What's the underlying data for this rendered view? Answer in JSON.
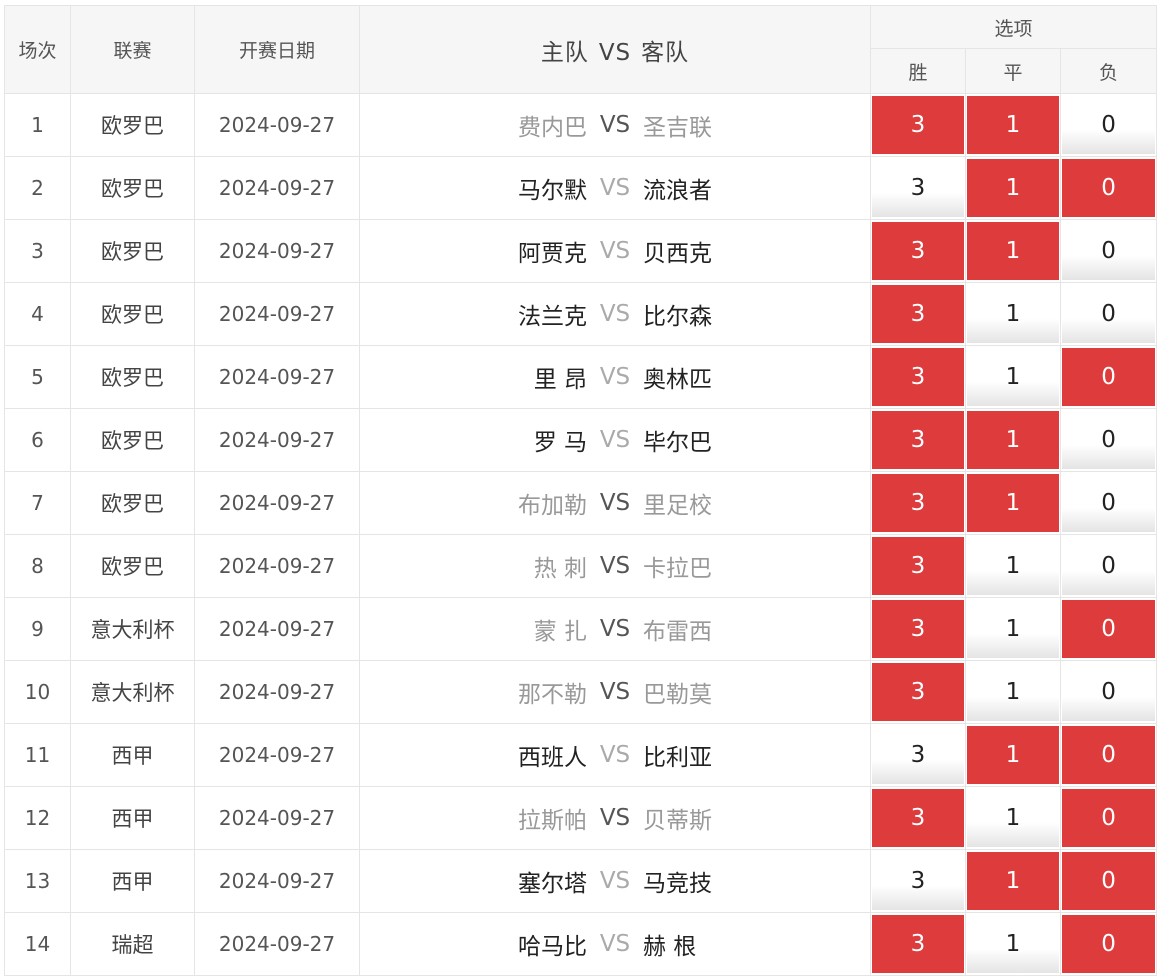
{
  "header": {
    "col_index": "场次",
    "col_league": "联赛",
    "col_date": "开赛日期",
    "col_home": "主队",
    "col_vs": "VS",
    "col_away": "客队",
    "col_options": "选项",
    "col_win": "胜",
    "col_draw": "平",
    "col_loss": "负"
  },
  "colors": {
    "selected": "#dd3b3c"
  },
  "rows": [
    {
      "idx": "1",
      "league": "欧罗巴",
      "date": "2024-09-27",
      "home": "费内巴",
      "vs": "VS",
      "away": "圣吉联",
      "style": "dim",
      "win": "3",
      "draw": "1",
      "loss": "0",
      "win_sel": true,
      "draw_sel": true,
      "loss_sel": false
    },
    {
      "idx": "2",
      "league": "欧罗巴",
      "date": "2024-09-27",
      "home": "马尔默",
      "vs": "VS",
      "away": "流浪者",
      "style": "sat",
      "win": "3",
      "draw": "1",
      "loss": "0",
      "win_sel": false,
      "draw_sel": true,
      "loss_sel": true
    },
    {
      "idx": "3",
      "league": "欧罗巴",
      "date": "2024-09-27",
      "home": "阿贾克",
      "vs": "VS",
      "away": "贝西克",
      "style": "sat",
      "win": "3",
      "draw": "1",
      "loss": "0",
      "win_sel": true,
      "draw_sel": true,
      "loss_sel": false
    },
    {
      "idx": "4",
      "league": "欧罗巴",
      "date": "2024-09-27",
      "home": "法兰克",
      "vs": "VS",
      "away": "比尔森",
      "style": "sat",
      "win": "3",
      "draw": "1",
      "loss": "0",
      "win_sel": true,
      "draw_sel": false,
      "loss_sel": false
    },
    {
      "idx": "5",
      "league": "欧罗巴",
      "date": "2024-09-27",
      "home": "里 昂",
      "vs": "VS",
      "away": "奥林匹",
      "style": "sat",
      "win": "3",
      "draw": "1",
      "loss": "0",
      "win_sel": true,
      "draw_sel": false,
      "loss_sel": true
    },
    {
      "idx": "6",
      "league": "欧罗巴",
      "date": "2024-09-27",
      "home": "罗 马",
      "vs": "VS",
      "away": "毕尔巴",
      "style": "sat",
      "win": "3",
      "draw": "1",
      "loss": "0",
      "win_sel": true,
      "draw_sel": true,
      "loss_sel": false
    },
    {
      "idx": "7",
      "league": "欧罗巴",
      "date": "2024-09-27",
      "home": "布加勒",
      "vs": "VS",
      "away": "里足校",
      "style": "dim",
      "win": "3",
      "draw": "1",
      "loss": "0",
      "win_sel": true,
      "draw_sel": true,
      "loss_sel": false
    },
    {
      "idx": "8",
      "league": "欧罗巴",
      "date": "2024-09-27",
      "home": "热 刺",
      "vs": "VS",
      "away": "卡拉巴",
      "style": "dim",
      "win": "3",
      "draw": "1",
      "loss": "0",
      "win_sel": true,
      "draw_sel": false,
      "loss_sel": false
    },
    {
      "idx": "9",
      "league": "意大利杯",
      "date": "2024-09-27",
      "home": "蒙 扎",
      "vs": "VS",
      "away": "布雷西",
      "style": "dim",
      "win": "3",
      "draw": "1",
      "loss": "0",
      "win_sel": true,
      "draw_sel": false,
      "loss_sel": true
    },
    {
      "idx": "10",
      "league": "意大利杯",
      "date": "2024-09-27",
      "home": "那不勒",
      "vs": "VS",
      "away": "巴勒莫",
      "style": "dim",
      "win": "3",
      "draw": "1",
      "loss": "0",
      "win_sel": true,
      "draw_sel": false,
      "loss_sel": false
    },
    {
      "idx": "11",
      "league": "西甲",
      "date": "2024-09-27",
      "home": "西班人",
      "vs": "VS",
      "away": "比利亚",
      "style": "sat",
      "win": "3",
      "draw": "1",
      "loss": "0",
      "win_sel": false,
      "draw_sel": true,
      "loss_sel": true
    },
    {
      "idx": "12",
      "league": "西甲",
      "date": "2024-09-27",
      "home": "拉斯帕",
      "vs": "VS",
      "away": "贝蒂斯",
      "style": "dim",
      "win": "3",
      "draw": "1",
      "loss": "0",
      "win_sel": true,
      "draw_sel": false,
      "loss_sel": true
    },
    {
      "idx": "13",
      "league": "西甲",
      "date": "2024-09-27",
      "home": "塞尔塔",
      "vs": "VS",
      "away": "马竞技",
      "style": "sat",
      "win": "3",
      "draw": "1",
      "loss": "0",
      "win_sel": false,
      "draw_sel": true,
      "loss_sel": true
    },
    {
      "idx": "14",
      "league": "瑞超",
      "date": "2024-09-27",
      "home": "哈马比",
      "vs": "VS",
      "away": "赫 根",
      "style": "sat",
      "win": "3",
      "draw": "1",
      "loss": "0",
      "win_sel": true,
      "draw_sel": false,
      "loss_sel": true
    }
  ]
}
